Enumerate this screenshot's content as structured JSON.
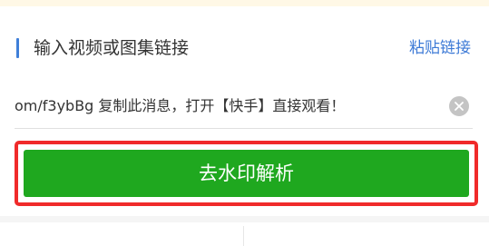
{
  "section": {
    "title": "输入视频或图集链接",
    "paste_label": "粘贴链接"
  },
  "input": {
    "value": "om/f3ybBg 复制此消息，打开【快手】直接观看！",
    "clear_icon": "close-circle-icon"
  },
  "action": {
    "label": "去水印解析"
  },
  "colors": {
    "accent": "#3f7fd9",
    "link": "#3d7ad6",
    "button": "#1fa81f",
    "highlight_border": "#f02a2a"
  }
}
